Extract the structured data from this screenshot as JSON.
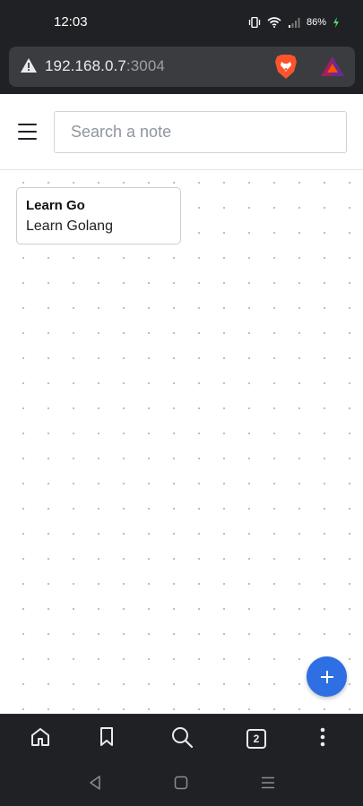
{
  "status_bar": {
    "time": "12:03",
    "battery_percent": "86%",
    "icons": [
      "vibrate-icon",
      "wifi-icon",
      "signal-icon",
      "battery-charging-icon"
    ]
  },
  "browser": {
    "url_host": "192.168.0.7",
    "url_port": ":3004",
    "icons": [
      "not-secure-warning-icon",
      "brave-shields-icon",
      "brave-rewards-icon"
    ],
    "toolbar": {
      "tab_count": "2",
      "icons": [
        "home-icon",
        "bookmark-icon",
        "search-icon",
        "tabs-icon",
        "more-vert-icon"
      ]
    }
  },
  "app": {
    "search": {
      "placeholder": "Search a note",
      "value": ""
    },
    "notes": [
      {
        "title": "Learn Go",
        "body": "Learn Golang"
      }
    ],
    "icons": [
      "hamburger-menu-icon",
      "plus-icon"
    ],
    "colors": {
      "fab": "#2f6fe4",
      "background": "#ffffff",
      "dot_grid": "#b3b8c4"
    }
  },
  "system_nav": {
    "icons": [
      "back-icon",
      "home-square-icon",
      "recents-icon"
    ]
  }
}
